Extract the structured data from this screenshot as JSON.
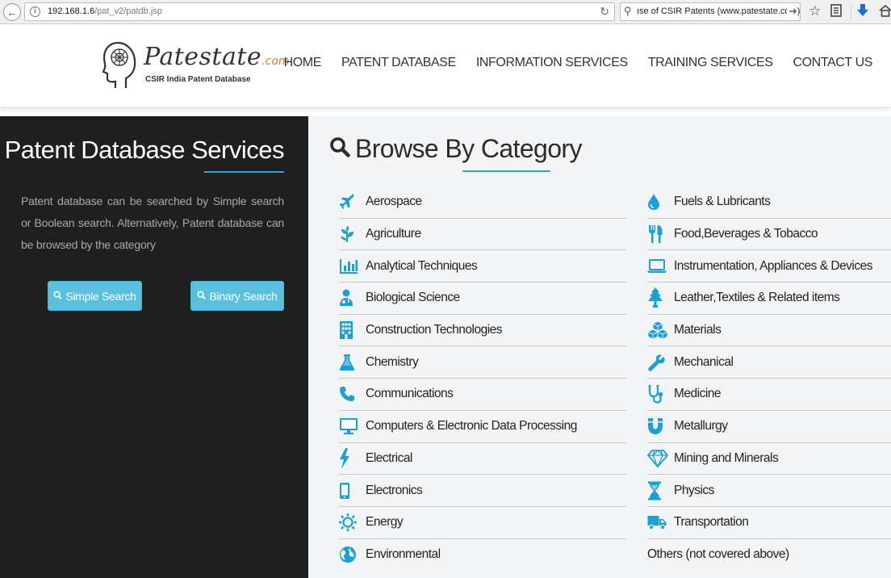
{
  "browser": {
    "url_host": "192.168.1.6",
    "url_path": "/pat_v2/patdb.jsp",
    "search_text": "ıse of CSIR Patents (www.patestate.com)"
  },
  "header": {
    "logo_name": "Patestate",
    "logo_suffix": ".com",
    "logo_tagline": "CSIR India Patent Database",
    "nav": [
      "HOME",
      "PATENT DATABASE",
      "INFORMATION SERVICES",
      "TRAINING SERVICES",
      "CONTACT US"
    ]
  },
  "left_panel": {
    "title": "Patent Database Services",
    "description": "Patent database can be searched by Simple search or Boolean search. Alternatively, Patent database can be browsed by the category",
    "simple_search_label": "Simple Search",
    "binary_search_label": "Binary Search"
  },
  "browse": {
    "title": "Browse By Category",
    "column_left": [
      {
        "label": "Aerospace",
        "icon": "plane-icon"
      },
      {
        "label": "Agriculture",
        "icon": "leaf-icon"
      },
      {
        "label": "Analytical Techniques",
        "icon": "bar-chart-icon"
      },
      {
        "label": "Biological Science",
        "icon": "doctor-icon"
      },
      {
        "label": "Construction Technologies",
        "icon": "building-icon"
      },
      {
        "label": "Chemistry",
        "icon": "flask-icon"
      },
      {
        "label": "Communications",
        "icon": "phone-icon"
      },
      {
        "label": "Computers & Electronic Data Processing",
        "icon": "desktop-icon"
      },
      {
        "label": "Electrical",
        "icon": "bolt-icon"
      },
      {
        "label": "Electronics",
        "icon": "mobile-icon"
      },
      {
        "label": "Energy",
        "icon": "sun-icon"
      },
      {
        "label": "Environmental",
        "icon": "globe-icon"
      }
    ],
    "column_right": [
      {
        "label": "Fuels & Lubricants",
        "icon": "drop-icon"
      },
      {
        "label": "Food,Beverages & Tobacco",
        "icon": "cutlery-icon"
      },
      {
        "label": "Instrumentation, Appliances & Devices",
        "icon": "laptop-icon"
      },
      {
        "label": "Leather,Textiles & Related items",
        "icon": "tree-icon"
      },
      {
        "label": "Materials",
        "icon": "cubes-icon"
      },
      {
        "label": "Mechanical",
        "icon": "wrench-icon"
      },
      {
        "label": "Medicine",
        "icon": "stethoscope-icon"
      },
      {
        "label": "Metallurgy",
        "icon": "magnet-icon"
      },
      {
        "label": "Mining and Minerals",
        "icon": "diamond-icon"
      },
      {
        "label": "Physics",
        "icon": "hourglass-icon"
      },
      {
        "label": "Transportation",
        "icon": "truck-icon"
      },
      {
        "label": "Others (not covered above)",
        "icon": ""
      }
    ]
  },
  "colors": {
    "accent": "#2aa9e0",
    "icon_blue": "#1a9fd8",
    "button": "#5bc0de",
    "panel_dark": "#1f1f1f"
  }
}
